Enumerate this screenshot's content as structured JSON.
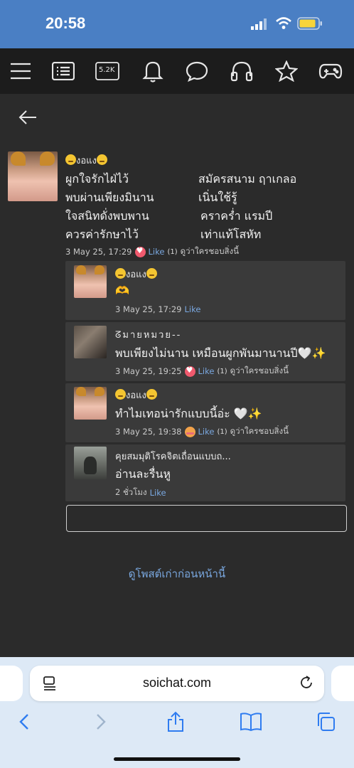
{
  "status": {
    "time": "20:58"
  },
  "nav": {
    "icons": [
      "menu-icon",
      "list-icon",
      "count-badge-icon",
      "bell-icon",
      "chat-icon",
      "headphones-icon",
      "star-icon",
      "gamepad-icon"
    ],
    "count_badge": "5.2K"
  },
  "post": {
    "username": "งอแง",
    "poem": [
      {
        "left": "ผูกใจรักไฝ่ไว้",
        "right": "สมัครสนาม ฤาเกลอ"
      },
      {
        "left": "พบผ่านเพียงมินาน",
        "right": "เนิ่นใช้รู้"
      },
      {
        "left": "ใจสนิทดั่งพบพาน",
        "right": "คราคร่ำ แรมปี"
      },
      {
        "left": "ควรค่ารักษาไว้",
        "right": "เท่าแท้โสหัท"
      }
    ],
    "date": "3 May 25, 17:29",
    "like": "Like",
    "like_count": "(1)",
    "who_likes": "ดูว่าใครชอบสิ่งนี้"
  },
  "replies": [
    {
      "username": "งอแง",
      "text": "🫶",
      "date": "3 May 25, 17:29",
      "like": "Like",
      "like_count": "",
      "who_likes": ""
    },
    {
      "username": "ᘔมายหมวย--",
      "text": "พบเพียงไม่นาน เหมือนผูกพันมานานปี🤍✨",
      "date": "3 May 25, 19:25",
      "like": "Like",
      "like_count": "(1)",
      "who_likes": "ดูว่าใครชอบสิ่งนี้"
    },
    {
      "username": "งอแง",
      "text": "ทำไมเทอน่ารักแบบนี้อ่ะ 🤍✨",
      "date": "3 May 25, 19:38",
      "like": "Like",
      "like_count": "(1)",
      "who_likes": "ดูว่าใครชอบสิ่งนี้"
    },
    {
      "username": "คุยสมมุติโรคจิตเถื่อนแบบถ...",
      "text": "อ่านละรื่นหู",
      "date": "2 ชั่วโมง",
      "like": "Like",
      "like_count": "",
      "who_likes": ""
    }
  ],
  "reply_input": {
    "placeholder": ""
  },
  "older_link": "ดูโพสต์เก่าก่อนหน้านี้",
  "browser": {
    "url": "soichat.com",
    "colors": {
      "accent": "#2f7cf0",
      "link": "#7aa8e0",
      "status_bar": "#4a7fc4"
    }
  }
}
